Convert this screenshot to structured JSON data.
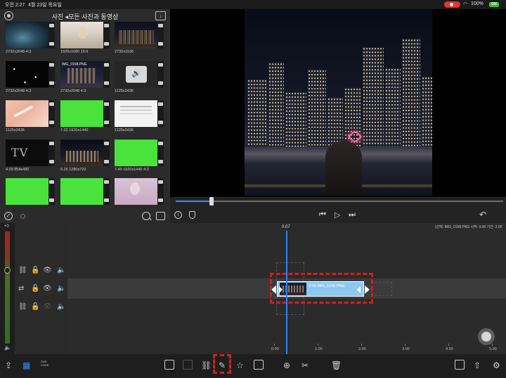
{
  "status_bar": {
    "time": "오전 2:27",
    "date": "4월 23일 목요일",
    "battery": "100%",
    "battery_badge": "ON"
  },
  "media_browser": {
    "title": "사진 ◂모든 사진과 동영상",
    "thumbnails": [
      {
        "caption": "2732x2048  4:3",
        "kind": "galaxy"
      },
      {
        "caption": "1920x1080  16:9",
        "kind": "woman"
      },
      {
        "caption": "2732x1536",
        "kind": "city"
      },
      {
        "caption": "2732x2048  4:3",
        "kind": "stars"
      },
      {
        "caption": "2732x2048  4:3",
        "kind": "night",
        "overlay": "IMG_0158.PNG"
      },
      {
        "caption": "1125x2436",
        "kind": "volume"
      },
      {
        "caption": "1125x2436",
        "kind": "peach"
      },
      {
        "caption": "7.22  1920x1440",
        "kind": "green"
      },
      {
        "caption": "1125x2436",
        "kind": "white"
      },
      {
        "caption": "4.00  854x480",
        "kind": "tv"
      },
      {
        "caption": "6.26  1280x720",
        "kind": "citynight2"
      },
      {
        "caption": "7.49  1920x1440  4:3",
        "kind": "green"
      },
      {
        "caption": "",
        "kind": "green"
      },
      {
        "caption": "",
        "kind": "green"
      },
      {
        "caption": "",
        "kind": "pink"
      }
    ]
  },
  "preview": {
    "progress_fraction": 0.11
  },
  "timeline": {
    "playhead_time": "0.07",
    "clip_info": "(선택: IMG_0158.PNG 시작: 0.00 기간: 2.00",
    "clip_label": "2.00  IMG_0158.PNG",
    "meter_top_label": "+0",
    "ruler": [
      "0.00",
      "1.00",
      "2.00",
      "3.00",
      "4.00",
      "5.00"
    ]
  },
  "toolbar": {
    "label_1": "SUB CODE"
  },
  "colors": {
    "accent_blue": "#2f7fff",
    "clip_blue": "#8cc9f2",
    "selection_red": "#d21f1f",
    "record_red": "#e3342f"
  }
}
